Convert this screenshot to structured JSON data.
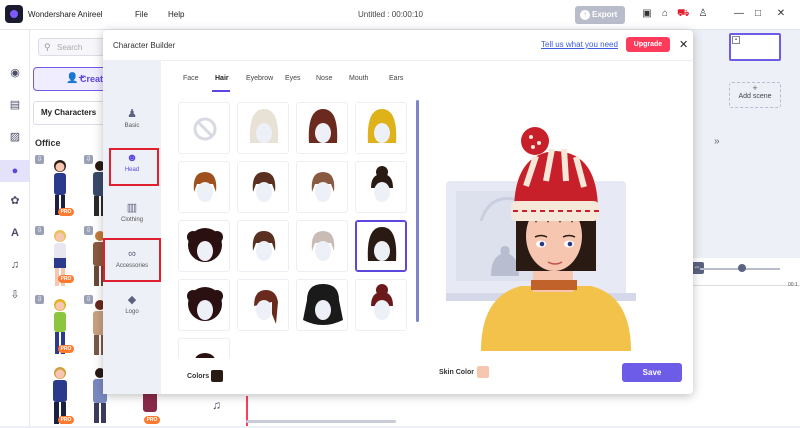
{
  "app": {
    "name": "Wondershare Anireel",
    "menu": [
      "File",
      "Help"
    ],
    "doc_title": "Untitled : 00:00:10",
    "export_label": "Export",
    "toolbar_icons": [
      "save-icon",
      "home-icon",
      "cart-icon",
      "user-icon"
    ],
    "window_controls": [
      "minimize-icon",
      "maximize-icon",
      "close-icon"
    ]
  },
  "left_rail": {
    "icons": [
      "palette-icon",
      "media-icon",
      "transition-icon",
      "character-icon",
      "props-icon",
      "text-icon",
      "music-icon",
      "import-icon"
    ],
    "active_index": 3
  },
  "library": {
    "search_placeholder": "Search",
    "create_label": "Create",
    "my_characters_label": "My Characters",
    "section_title": "Office",
    "pro_badge": "PRO"
  },
  "editor": {
    "add_scene_label": "Add scene",
    "timeline_time": "00:1"
  },
  "dialog": {
    "title": "Character Builder",
    "feedback_link": "Tell us what you need",
    "upgrade_label": "Upgrade",
    "categories": [
      {
        "label": "Basic",
        "icon": "person-icon"
      },
      {
        "label": "Head",
        "icon": "head-icon"
      },
      {
        "label": "Clothing",
        "icon": "shirt-icon"
      },
      {
        "label": "Accessories",
        "icon": "glasses-icon"
      },
      {
        "label": "Logo",
        "icon": "logo-icon"
      }
    ],
    "active_category": "Head",
    "subtabs": [
      "Face",
      "Hair",
      "Eyebrow",
      "Eyes",
      "Nose",
      "Mouth",
      "Ears"
    ],
    "active_subtab": "Hair",
    "hair_options": [
      {
        "style": "none",
        "color": ""
      },
      {
        "style": "braided-blonde",
        "color": "#e8e2d6"
      },
      {
        "style": "long-wavy",
        "color": "#6a2a1e"
      },
      {
        "style": "yellow-long",
        "color": "#e0b21a"
      },
      {
        "style": "short-bob",
        "color": "#a0501e"
      },
      {
        "style": "short-brown",
        "color": "#5a3020"
      },
      {
        "style": "short-light-brown",
        "color": "#8a5a40"
      },
      {
        "style": "bun",
        "color": "#2a1a14"
      },
      {
        "style": "afro-puffs",
        "color": "#2a1010"
      },
      {
        "style": "straight-shoulder",
        "color": "#5a3020"
      },
      {
        "style": "gray-short",
        "color": "#c9bcb4"
      },
      {
        "style": "black-long-bangs",
        "color": "#2a1a14"
      },
      {
        "style": "afro",
        "color": "#2a1010"
      },
      {
        "style": "ponytail",
        "color": "#6a2a1e"
      },
      {
        "style": "black-curly",
        "color": "#1a1a1a"
      },
      {
        "style": "top-bun",
        "color": "#6a1a1a"
      },
      {
        "style": "partial",
        "color": "#2a1010"
      }
    ],
    "selected_option_index": 11,
    "colors_label": "Colors",
    "hair_color": "#2a1a14",
    "skin_color_label": "Skin Color",
    "skin_color": "#f6c6b0",
    "save_label": "Save"
  },
  "theme": {
    "accent": "#6c5ce7",
    "upgrade": "#ff3b5c",
    "highlight": "#e0202f"
  }
}
